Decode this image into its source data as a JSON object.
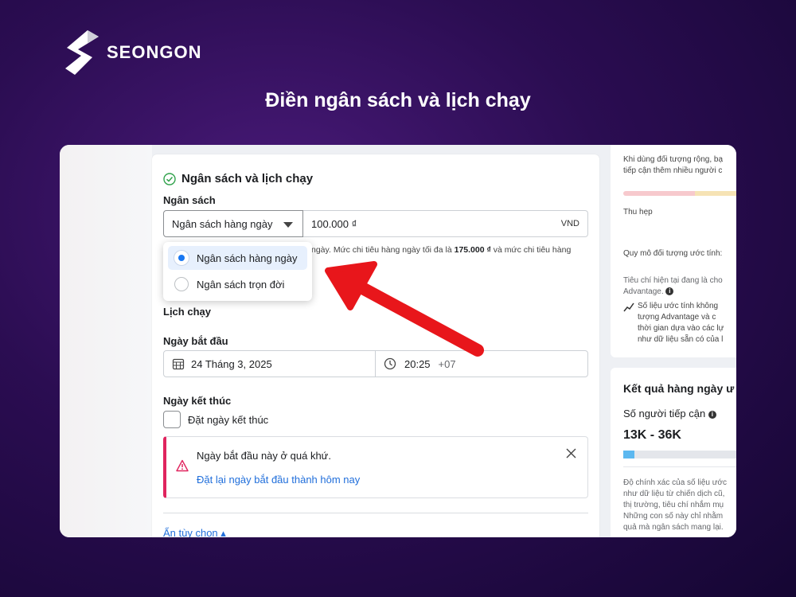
{
  "brand": {
    "name": "SEONGON"
  },
  "headline": "Điền ngân sách và lịch chạy",
  "section": {
    "title": "Ngân sách và lịch chạy",
    "budget_label": "Ngân sách",
    "budget_type": "Ngân sách hàng ngày",
    "amount": "100.000 ₫",
    "currency": "VND",
    "hint_prefix": "ngày. Mức chi tiêu hàng ngày tối đa là ",
    "hint_max": "175.000 ₫",
    "hint_suffix": " và mức chi tiêu hàng",
    "dropdown_options": [
      "Ngân sách hàng ngày",
      "Ngân sách trọn đời"
    ],
    "selected_option": "Ngân sách hàng ngày",
    "schedule_label": "Lịch chạy",
    "start_label": "Ngày bắt đầu",
    "start_date": "24 Tháng 3, 2025",
    "start_time": "20:25",
    "timezone": "+07",
    "end_label": "Ngày kết thúc",
    "end_checkbox": "Đặt ngày kết thúc",
    "warning_text": "Ngày bắt đầu này ở quá khứ.",
    "warning_link": "Đặt lại ngày bắt đầu thành hôm nay",
    "toggle_options": "Ẩn tùy chọn"
  },
  "audience_panel": {
    "line1": "Khi dùng đối tượng rộng, bạ",
    "line2": "tiếp cận thêm nhiều người c",
    "narrow": "Thu hẹp",
    "size_label": "Quy mô đối tượng ước tính:",
    "crit1": "Tiêu chí hiện tại đang là cho",
    "crit2": "Advantage.",
    "est1": "Số liệu ước tính không",
    "est2": "tượng Advantage và c",
    "est3": "thời gian dựa vào các lự",
    "est4": "như dữ liệu sẵn có của l"
  },
  "results_panel": {
    "title": "Kết quả hàng ngày ư",
    "reach_label": "Số người tiếp cận",
    "reach_range": "13K - 36K",
    "reach_fill": 0.09,
    "note1": "Độ chính xác của số liệu ước",
    "note2": "như dữ liệu từ chiến dịch cũ,",
    "note3": "thị trường, tiêu chí nhắm mụ",
    "note4": "Những con số này chỉ nhằm",
    "note5": "quả mà ngân sách mang lại."
  },
  "colors": {
    "accent": "#1877f2",
    "warning": "#e0245e",
    "link": "#216fdb",
    "arrow": "#e8161b"
  }
}
